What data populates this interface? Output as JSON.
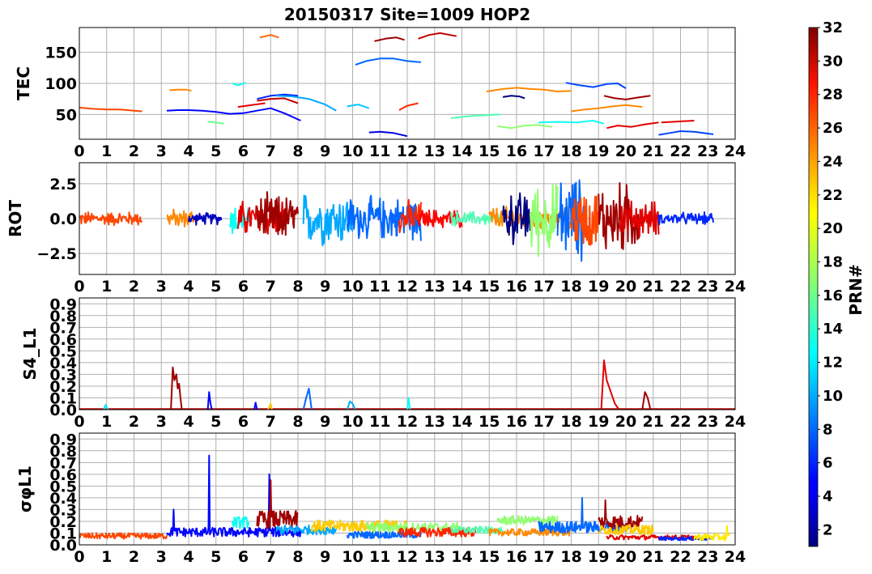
{
  "figure": {
    "title": "20150317 Site=1009 HOP2",
    "colorbar_label": "PRN#",
    "colorbar_ticks": [
      2,
      4,
      6,
      8,
      10,
      12,
      14,
      16,
      18,
      20,
      22,
      24,
      26,
      28,
      30,
      32
    ],
    "colorbar_range": [
      1,
      32
    ],
    "colormap": "jet"
  },
  "chart_data": [
    {
      "type": "line",
      "ylabel": "TEC",
      "xlim": [
        0,
        24
      ],
      "ylim": [
        10,
        190
      ],
      "yticks": [
        50,
        100,
        150
      ],
      "ytick_labels": [
        "50",
        "100",
        "150"
      ],
      "xticks": [
        0,
        1,
        2,
        3,
        4,
        5,
        6,
        7,
        8,
        9,
        10,
        11,
        12,
        13,
        14,
        15,
        16,
        17,
        18,
        19,
        20,
        21,
        22,
        23,
        24
      ],
      "grid": true,
      "series": [
        {
          "prn": 26,
          "x": [
            0,
            0.5,
            1.0,
            1.5,
            2.0,
            2.3
          ],
          "y": [
            61,
            59,
            58,
            58,
            56,
            55
          ]
        },
        {
          "prn": 5,
          "x": [
            3.2,
            3.6,
            4.0,
            4.5,
            5.0,
            5.5,
            6.0,
            6.5,
            7.0,
            7.5,
            8.1
          ],
          "y": [
            56,
            57,
            57,
            56,
            54,
            51,
            52,
            56,
            60,
            52,
            40
          ]
        },
        {
          "prn": 24,
          "x": [
            3.3,
            3.6,
            3.9,
            4.1
          ],
          "y": [
            89,
            90,
            90,
            88
          ]
        },
        {
          "prn": 16,
          "x": [
            4.7,
            5.0,
            5.3
          ],
          "y": [
            38,
            37,
            35
          ]
        },
        {
          "prn": 13,
          "x": [
            5.6,
            5.8,
            6.1
          ],
          "y": [
            100,
            97,
            101
          ]
        },
        {
          "prn": 29,
          "x": [
            5.8,
            6.3,
            6.8
          ],
          "y": [
            62,
            65,
            68
          ]
        },
        {
          "prn": 25,
          "x": [
            6.6,
            7.0,
            7.3
          ],
          "y": [
            174,
            178,
            174
          ]
        },
        {
          "prn": 30,
          "x": [
            6.5,
            7.0,
            7.5,
            8.0
          ],
          "y": [
            72,
            75,
            76,
            68
          ]
        },
        {
          "prn": 6,
          "x": [
            6.5,
            7.0,
            7.5,
            8.0
          ],
          "y": [
            75,
            80,
            82,
            80
          ]
        },
        {
          "prn": 10,
          "x": [
            7.2,
            7.8,
            8.4,
            9.0,
            9.4
          ],
          "y": [
            80,
            79,
            75,
            66,
            56
          ]
        },
        {
          "prn": 11,
          "x": [
            9.8,
            10.2,
            10.6
          ],
          "y": [
            63,
            66,
            60
          ]
        },
        {
          "prn": 8,
          "x": [
            10.1,
            10.5,
            11.0,
            11.5,
            12.0,
            12.5
          ],
          "y": [
            130,
            136,
            140,
            140,
            136,
            134
          ]
        },
        {
          "prn": 31,
          "x": [
            10.8,
            11.2,
            11.6,
            11.9
          ],
          "y": [
            168,
            172,
            174,
            170
          ]
        },
        {
          "prn": 30,
          "x": [
            12.4,
            12.8,
            13.2,
            13.8
          ],
          "y": [
            172,
            178,
            181,
            176
          ]
        },
        {
          "prn": 4,
          "x": [
            10.6,
            11.0,
            11.5,
            12.0
          ],
          "y": [
            21,
            22,
            20,
            15
          ]
        },
        {
          "prn": 27,
          "x": [
            11.7,
            12.0,
            12.4
          ],
          "y": [
            57,
            64,
            68
          ]
        },
        {
          "prn": 15,
          "x": [
            13.6,
            14.0,
            14.5,
            15.0,
            15.4
          ],
          "y": [
            44,
            46,
            48,
            49,
            50
          ]
        },
        {
          "prn": 24,
          "x": [
            14.9,
            15.5,
            16.0,
            16.5,
            17.0,
            17.5,
            18.0
          ],
          "y": [
            87,
            91,
            93,
            91,
            90,
            87,
            88
          ]
        },
        {
          "prn": 1,
          "x": [
            15.5,
            15.8,
            16.1,
            16.3
          ],
          "y": [
            78,
            80,
            79,
            76
          ]
        },
        {
          "prn": 17,
          "x": [
            15.3,
            15.8,
            16.3,
            16.8,
            17.3
          ],
          "y": [
            31,
            28,
            32,
            33,
            30
          ]
        },
        {
          "prn": 13,
          "x": [
            16.8,
            17.5,
            18.2,
            18.8,
            19.2
          ],
          "y": [
            37,
            38,
            37,
            40,
            35
          ]
        },
        {
          "prn": 7,
          "x": [
            17.8,
            18.3,
            18.8,
            19.3,
            19.7,
            20.0
          ],
          "y": [
            101,
            97,
            94,
            99,
            100,
            92
          ]
        },
        {
          "prn": 24,
          "x": [
            18.0,
            18.5,
            19.0,
            19.5,
            20.0,
            20.6
          ],
          "y": [
            55,
            58,
            60,
            63,
            65,
            62
          ]
        },
        {
          "prn": 31,
          "x": [
            19.2,
            19.6,
            20.0,
            20.4,
            20.9
          ],
          "y": [
            80,
            76,
            74,
            77,
            80
          ]
        },
        {
          "prn": 29,
          "x": [
            19.3,
            19.7,
            20.2,
            20.7,
            21.2
          ],
          "y": [
            28,
            32,
            30,
            34,
            37
          ]
        },
        {
          "prn": 29,
          "x": [
            21.3,
            21.7,
            22.1,
            22.5
          ],
          "y": [
            37,
            38,
            39,
            40
          ]
        },
        {
          "prn": 7,
          "x": [
            21.2,
            21.6,
            22.0,
            22.5,
            23.2
          ],
          "y": [
            17,
            20,
            23,
            22,
            18
          ]
        }
      ]
    },
    {
      "type": "line",
      "ylabel": "ROT",
      "xlim": [
        0,
        24
      ],
      "ylim": [
        -4,
        4
      ],
      "yticks": [
        -2.5,
        0,
        2.5
      ],
      "ytick_labels": [
        "−2.5",
        "0.0",
        "2.5"
      ],
      "xticks": [
        0,
        1,
        2,
        3,
        4,
        5,
        6,
        7,
        8,
        9,
        10,
        11,
        12,
        13,
        14,
        15,
        16,
        17,
        18,
        19,
        20,
        21,
        22,
        23,
        24
      ],
      "grid": true,
      "series": [
        {
          "prn": 26,
          "x": [
            0,
            2.3
          ],
          "amp": 0.6
        },
        {
          "prn": 24,
          "x": [
            3.2,
            4.2
          ],
          "amp": 0.8
        },
        {
          "prn": 3,
          "x": [
            4.0,
            5.2
          ],
          "amp": 0.5
        },
        {
          "prn": 13,
          "x": [
            5.5,
            6.2
          ],
          "amp": 1.5
        },
        {
          "prn": 29,
          "x": [
            5.8,
            7.5
          ],
          "amp": 1.5
        },
        {
          "prn": 31,
          "x": [
            6.5,
            8.0
          ],
          "amp": 2.0
        },
        {
          "prn": 10,
          "x": [
            8.2,
            10.0
          ],
          "amp": 2.2
        },
        {
          "prn": 8,
          "x": [
            9.8,
            12.5
          ],
          "amp": 1.8
        },
        {
          "prn": 27,
          "x": [
            11.7,
            12.5
          ],
          "amp": 1.5
        },
        {
          "prn": 28,
          "x": [
            12.4,
            14.0
          ],
          "amp": 0.8
        },
        {
          "prn": 15,
          "x": [
            13.6,
            15.5
          ],
          "amp": 0.6
        },
        {
          "prn": 24,
          "x": [
            15.0,
            18.0
          ],
          "amp": 1.0
        },
        {
          "prn": 1,
          "x": [
            15.5,
            16.5
          ],
          "amp": 2.2
        },
        {
          "prn": 17,
          "x": [
            16.5,
            17.5
          ],
          "amp": 3.0
        },
        {
          "prn": 8,
          "x": [
            17.5,
            18.5
          ],
          "amp": 3.5
        },
        {
          "prn": 26,
          "x": [
            18.0,
            19.0
          ],
          "amp": 2.5
        },
        {
          "prn": 31,
          "x": [
            19.0,
            20.5
          ],
          "amp": 3.0
        },
        {
          "prn": 29,
          "x": [
            19.8,
            21.2
          ],
          "amp": 1.5
        },
        {
          "prn": 6,
          "x": [
            21.2,
            23.2
          ],
          "amp": 0.5
        }
      ]
    },
    {
      "type": "line",
      "ylabel": "S4_L1",
      "xlim": [
        0,
        24
      ],
      "ylim": [
        0,
        0.95
      ],
      "yticks": [
        0,
        0.1,
        0.2,
        0.3,
        0.4,
        0.5,
        0.6,
        0.7,
        0.8,
        0.9
      ],
      "ytick_labels": [
        "0.0",
        "0.1",
        "0.2",
        "0.3",
        "0.4",
        "0.5",
        "0.6",
        "0.7",
        "0.8",
        "0.9"
      ],
      "xticks": [
        0,
        1,
        2,
        3,
        4,
        5,
        6,
        7,
        8,
        9,
        10,
        11,
        12,
        13,
        14,
        15,
        16,
        17,
        18,
        19,
        20,
        21,
        22,
        23,
        24
      ],
      "grid": true,
      "baseline": {
        "prn": 30,
        "x": [
          0,
          24
        ],
        "y": 0.005
      },
      "series": [
        {
          "prn": 12,
          "x": [
            0.9,
            0.95,
            1.0,
            1.05
          ],
          "y": [
            0.0,
            0.04,
            0.02,
            0.0
          ]
        },
        {
          "prn": 31,
          "x": [
            3.35,
            3.42,
            3.48,
            3.55,
            3.6,
            3.65,
            3.7,
            3.75
          ],
          "y": [
            0.0,
            0.36,
            0.25,
            0.3,
            0.18,
            0.22,
            0.1,
            0.0
          ]
        },
        {
          "prn": 5,
          "x": [
            4.7,
            4.75,
            4.8,
            4.85
          ],
          "y": [
            0.0,
            0.15,
            0.05,
            0.0
          ]
        },
        {
          "prn": 5,
          "x": [
            6.4,
            6.45,
            6.5
          ],
          "y": [
            0.0,
            0.06,
            0.0
          ]
        },
        {
          "prn": 22,
          "x": [
            6.9,
            7.0,
            7.05
          ],
          "y": [
            0.0,
            0.05,
            0.0
          ]
        },
        {
          "prn": 8,
          "x": [
            8.2,
            8.3,
            8.4,
            8.5
          ],
          "y": [
            0.0,
            0.1,
            0.18,
            0.0
          ]
        },
        {
          "prn": 10,
          "x": [
            9.8,
            9.9,
            10.0,
            10.1
          ],
          "y": [
            0.0,
            0.07,
            0.05,
            0.0
          ]
        },
        {
          "prn": 13,
          "x": [
            12.0,
            12.05,
            12.1
          ],
          "y": [
            0.0,
            0.1,
            0.0
          ]
        },
        {
          "prn": 29,
          "x": [
            19.1,
            19.2,
            19.3,
            19.45,
            19.6,
            19.75
          ],
          "y": [
            0.0,
            0.42,
            0.25,
            0.15,
            0.05,
            0.0
          ]
        },
        {
          "prn": 31,
          "x": [
            20.6,
            20.7,
            20.8,
            20.9
          ],
          "y": [
            0.0,
            0.15,
            0.1,
            0.0
          ]
        }
      ]
    },
    {
      "type": "line",
      "ylabel": "σφL1",
      "xlim": [
        0,
        24
      ],
      "ylim": [
        0,
        0.95
      ],
      "yticks": [
        0,
        0.1,
        0.2,
        0.3,
        0.4,
        0.5,
        0.6,
        0.7,
        0.8,
        0.9
      ],
      "ytick_labels": [
        "0.0",
        "0.1",
        "0.2",
        "0.3",
        "0.4",
        "0.5",
        "0.6",
        "0.7",
        "0.8",
        "0.9"
      ],
      "xticks": [
        0,
        1,
        2,
        3,
        4,
        5,
        6,
        7,
        8,
        9,
        10,
        11,
        12,
        13,
        14,
        15,
        16,
        17,
        18,
        19,
        20,
        21,
        22,
        23,
        24
      ],
      "grid": true,
      "series": [
        {
          "prn": 26,
          "x": [
            0,
            3.2
          ],
          "base": 0.07,
          "amp": 0.05
        },
        {
          "prn": 5,
          "x": [
            3.2,
            8.1
          ],
          "base": 0.1,
          "amp": 0.08,
          "spikes": [
            [
              3.45,
              0.3
            ],
            [
              4.75,
              0.76
            ],
            [
              6.95,
              0.6
            ]
          ]
        },
        {
          "prn": 13,
          "x": [
            5.6,
            6.2
          ],
          "base": 0.18,
          "amp": 0.1
        },
        {
          "prn": 31,
          "x": [
            6.5,
            8.0
          ],
          "base": 0.2,
          "amp": 0.15,
          "spikes": [
            [
              7.0,
              0.55
            ]
          ]
        },
        {
          "prn": 10,
          "x": [
            7.2,
            9.4
          ],
          "base": 0.12,
          "amp": 0.08
        },
        {
          "prn": 22,
          "x": [
            8.5,
            12.0
          ],
          "base": 0.15,
          "amp": 0.1
        },
        {
          "prn": 8,
          "x": [
            9.8,
            12.5
          ],
          "base": 0.08,
          "amp": 0.06
        },
        {
          "prn": 17,
          "x": [
            10.5,
            14.0
          ],
          "base": 0.14,
          "amp": 0.08
        },
        {
          "prn": 27,
          "x": [
            11.7,
            14.5
          ],
          "base": 0.1,
          "amp": 0.08
        },
        {
          "prn": 15,
          "x": [
            13.6,
            15.5
          ],
          "base": 0.12,
          "amp": 0.06
        },
        {
          "prn": 24,
          "x": [
            15.0,
            18.0
          ],
          "base": 0.1,
          "amp": 0.06
        },
        {
          "prn": 17,
          "x": [
            15.3,
            17.5
          ],
          "base": 0.2,
          "amp": 0.08
        },
        {
          "prn": 8,
          "x": [
            16.8,
            20.0
          ],
          "base": 0.14,
          "amp": 0.1,
          "spikes": [
            [
              18.4,
              0.4
            ]
          ]
        },
        {
          "prn": 31,
          "x": [
            19.0,
            20.6
          ],
          "base": 0.18,
          "amp": 0.12,
          "spikes": [
            [
              19.25,
              0.38
            ]
          ]
        },
        {
          "prn": 22,
          "x": [
            19.0,
            21.0
          ],
          "base": 0.12,
          "amp": 0.08
        },
        {
          "prn": 29,
          "x": [
            19.3,
            22.5
          ],
          "base": 0.06,
          "amp": 0.04
        },
        {
          "prn": 6,
          "x": [
            21.2,
            23.2
          ],
          "base": 0.05,
          "amp": 0.03
        },
        {
          "prn": 21,
          "x": [
            22.5,
            23.8
          ],
          "base": 0.06,
          "amp": 0.06,
          "spikes": [
            [
              23.7,
              0.16
            ]
          ]
        }
      ]
    }
  ]
}
